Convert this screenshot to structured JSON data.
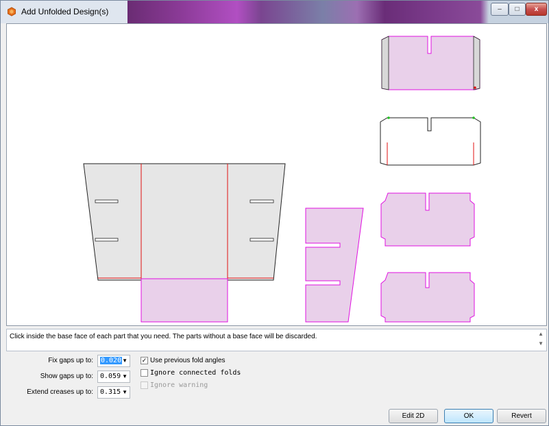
{
  "window": {
    "title": "Add Unfolded Design(s)",
    "app_icon": "orange-hexagon-icon",
    "controls": {
      "minimize": "–",
      "maximize": "□",
      "close": "x"
    }
  },
  "canvas": {
    "description_colors": {
      "selected_fill": "#e9d0ea",
      "selected_stroke": "#e010e0",
      "unselected_fill": "#e6e6e6",
      "crease": "#e01010"
    }
  },
  "message": {
    "text": "Click inside the base face of each part that you need. The parts without a base face will be discarded."
  },
  "options": {
    "fix_gaps": {
      "label": "Fix gaps up to:",
      "value": "0.020"
    },
    "show_gaps": {
      "label": "Show gaps up to:",
      "value": "0.059"
    },
    "extend_creases": {
      "label": "Extend creases up to:",
      "value": "0.315"
    },
    "use_previous_fold_angles": {
      "label": "Use previous fold angles",
      "checked": true
    },
    "ignore_connected_folds": {
      "label": "Ignore connected folds",
      "checked": false
    },
    "ignore_warning": {
      "label": "Ignore warning",
      "checked": false,
      "disabled": true
    }
  },
  "buttons": {
    "edit2d": "Edit 2D",
    "ok": "OK",
    "revert": "Revert"
  }
}
